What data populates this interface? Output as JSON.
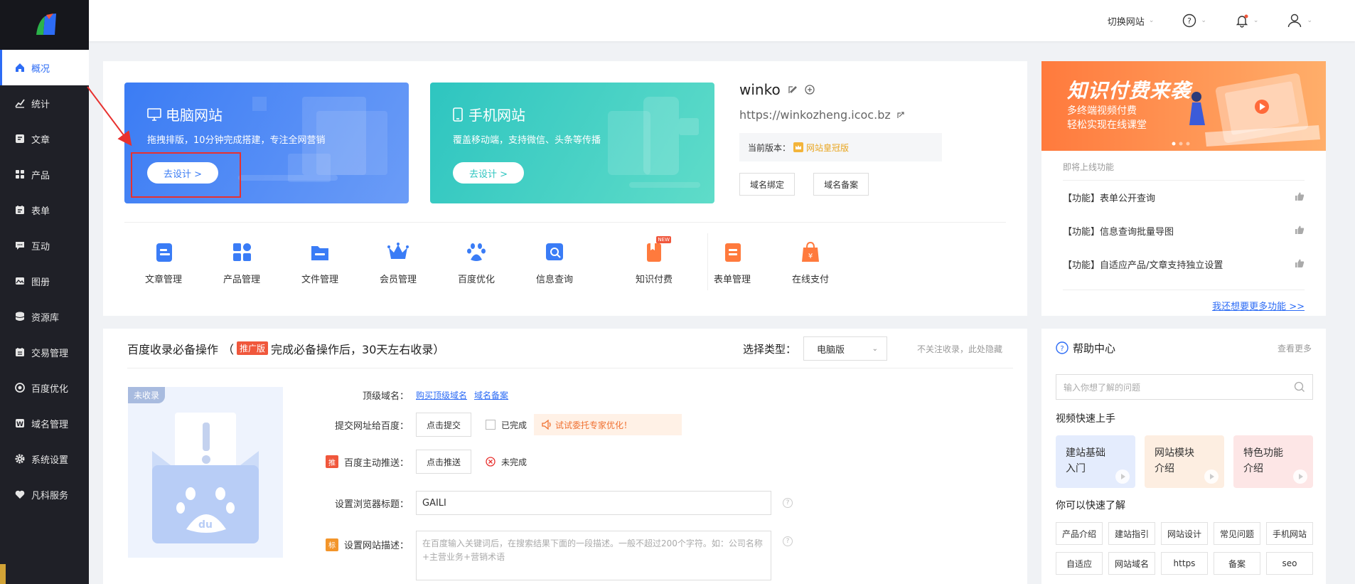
{
  "sidebar": {
    "items": [
      {
        "label": "概况",
        "icon": "home-icon"
      },
      {
        "label": "统计",
        "icon": "stats-icon"
      },
      {
        "label": "文章",
        "icon": "article-icon"
      },
      {
        "label": "产品",
        "icon": "product-icon"
      },
      {
        "label": "表单",
        "icon": "form-icon"
      },
      {
        "label": "互动",
        "icon": "chat-icon"
      },
      {
        "label": "图册",
        "icon": "album-icon"
      },
      {
        "label": "资源库",
        "icon": "database-icon"
      },
      {
        "label": "交易管理",
        "icon": "trade-icon"
      },
      {
        "label": "百度优化",
        "icon": "seo-icon"
      },
      {
        "label": "域名管理",
        "icon": "domain-icon"
      },
      {
        "label": "系统设置",
        "icon": "gear-icon"
      },
      {
        "label": "凡科服务",
        "icon": "heart-icon"
      }
    ]
  },
  "header": {
    "switch_site": "切换网站"
  },
  "pc_banner": {
    "title": "电脑网站",
    "desc": "拖拽排版，10分钟完成搭建，专注全网营销",
    "button": "去设计 >"
  },
  "mobile_banner": {
    "title": "手机网站",
    "desc": "覆盖移动端，支持微信、头条等传播",
    "button": "去设计 >"
  },
  "site": {
    "name": "winko",
    "url": "https://winkozheng.icoc.bz",
    "version_label": "当前版本：",
    "version": "网站皇冠版",
    "bind_domain": "域名绑定",
    "domain_record": "域名备案"
  },
  "quick_actions": [
    {
      "label": "文章管理",
      "icon": "article-manage-icon",
      "color": "#3a7cf6"
    },
    {
      "label": "产品管理",
      "icon": "product-manage-icon",
      "color": "#3a7cf6"
    },
    {
      "label": "文件管理",
      "icon": "folder-icon",
      "color": "#3a7cf6"
    },
    {
      "label": "会员管理",
      "icon": "crown-icon",
      "color": "#3a7cf6"
    },
    {
      "label": "百度优化",
      "icon": "paw-icon",
      "color": "#3a7cf6"
    },
    {
      "label": "信息查询",
      "icon": "search-doc-icon",
      "color": "#3a7cf6"
    },
    {
      "label": "知识付费",
      "icon": "knowledge-icon",
      "color": "#ff7a3d",
      "badge": "NEW"
    },
    {
      "label": "表单管理",
      "icon": "form-manage-icon",
      "color": "#ff7a3d"
    },
    {
      "label": "在线支付",
      "icon": "payment-icon",
      "color": "#ff7a3d"
    }
  ],
  "promo": {
    "title": "知识付费来袭",
    "line1": "多终端视频付费",
    "line2": "轻松实现在线课堂"
  },
  "upcoming": {
    "title": "即将上线功能",
    "items": [
      "【功能】表单公开查询",
      "【功能】信息查询批量导图",
      "【功能】自适应产品/文章支持独立设置"
    ],
    "more": "我还想要更多功能 >>"
  },
  "baidu": {
    "title": "百度收录必备操作",
    "paren_open": "（",
    "badge": "推广版",
    "subtitle": "完成必备操作后，30天左右收录",
    "paren_close": "）",
    "select_label": "选择类型：",
    "select_value": "电脑版",
    "hide": "不关注收录，此处隐藏",
    "status_tag": "未收录",
    "domain_label": "顶级域名：",
    "buy_domain": "购买顶级域名",
    "record_domain": "域名备案",
    "submit_label": "提交网址给百度：",
    "submit_btn": "点击提交",
    "done_label": "已完成",
    "entrust": "试试委托专家优化！",
    "push_tag": "推",
    "push_label": "百度主动推送：",
    "push_btn": "点击推送",
    "push_status": "未完成",
    "title_label": "设置浏览器标题：",
    "title_value": "GAILI",
    "desc_tag": "标",
    "desc_label": "设置网站描述：",
    "desc_placeholder": "在百度输入关键词后，在搜索结果下面的一段描述。一般不超过200个字符。如：公司名称+主营业务+营销术语"
  },
  "help": {
    "title": "帮助中心",
    "more": "查看更多",
    "search_placeholder": "输入你想了解的问题",
    "video_title": "视频快速上手",
    "videos": [
      {
        "line1": "建站基础",
        "line2": "入门",
        "color": "#e4ecfd"
      },
      {
        "line1": "网站模块",
        "line2": "介绍",
        "color": "#fdeee1"
      },
      {
        "line1": "特色功能",
        "line2": "介绍",
        "color": "#fde6e6"
      }
    ],
    "learn_title": "你可以快速了解",
    "tags": [
      "产品介绍",
      "建站指引",
      "网站设计",
      "常见问题",
      "手机网站",
      "自适应",
      "网站域名",
      "https",
      "备案",
      "seo"
    ]
  }
}
